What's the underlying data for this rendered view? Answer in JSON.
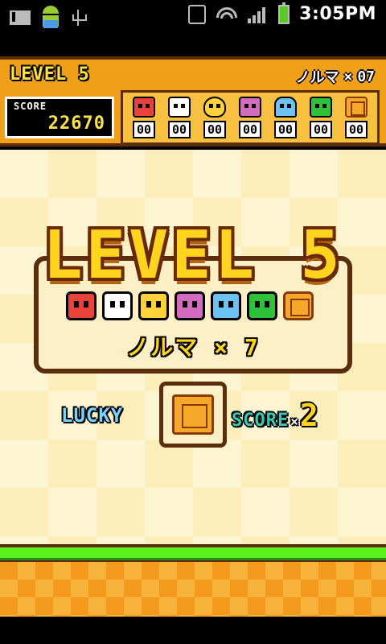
{
  "status_bar": {
    "time": "3:05PM",
    "icons": [
      "gmail-icon",
      "android-icon",
      "usb-icon",
      "vibrate-icon",
      "wifi-icon",
      "signal-icon",
      "battery-icon"
    ]
  },
  "header": {
    "level": "LEVEL 5",
    "quota_label": "ノルマ",
    "quota_times": "×",
    "quota_value": "07",
    "score_label": "SCORE",
    "score_value": "22670",
    "counters": [
      {
        "creature": "monkey",
        "count": "00",
        "color": "#e8423a"
      },
      {
        "creature": "panda",
        "count": "00",
        "color": "#ffffff"
      },
      {
        "creature": "giraffe",
        "count": "00",
        "color": "#ffd23a"
      },
      {
        "creature": "pig",
        "count": "00",
        "color": "#d36bc0"
      },
      {
        "creature": "squid",
        "count": "00",
        "color": "#6cc2f2"
      },
      {
        "creature": "frog",
        "count": "00",
        "color": "#2fc13a"
      },
      {
        "creature": "lucky-block",
        "count": "00",
        "color": "#f5a82a"
      }
    ]
  },
  "level_intro": {
    "title": "LEVEL 5",
    "creatures": [
      "monkey",
      "panda",
      "giraffe",
      "pig",
      "squid",
      "frog",
      "lucky-block"
    ],
    "quota_text": "ノルマ × 7"
  },
  "lucky": {
    "label": "LUCKY",
    "creature": "lucky-block",
    "score_word": "SCORE",
    "times": "×",
    "multiplier": "2"
  },
  "colors": {
    "header_bg": "#f0a018",
    "board_light": "#fdf4d2",
    "board_dark": "#fbeebb",
    "grass": "#5af01e",
    "dirt": "#f39a1e",
    "outline": "#5a2d0c",
    "title_yellow": "#ffd41e"
  }
}
